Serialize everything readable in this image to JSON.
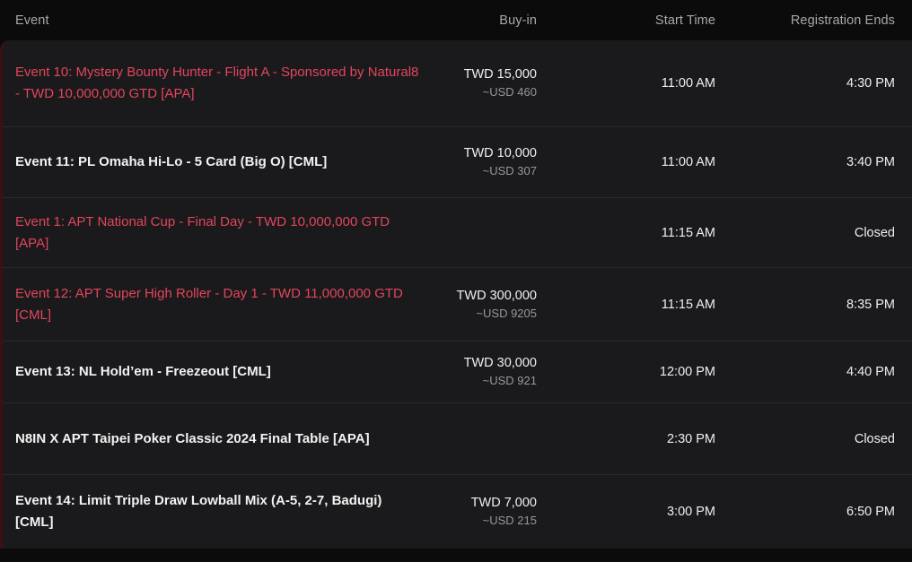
{
  "theme": {
    "page_bg": "#0b0b0b",
    "row_bg": "#1a1a1c",
    "row_divider": "#2a2a2d",
    "accent_red": "#e2455c",
    "accent_rail": "#3a1016",
    "text_primary": "#efefef",
    "text_muted": "#98989c",
    "header_text": "#a8a8ac"
  },
  "table": {
    "columns": {
      "event": "Event",
      "buyin": "Buy-in",
      "start_time": "Start Time",
      "registration_ends": "Registration Ends"
    },
    "rows": [
      {
        "event": "Event 10: Mystery Bounty Hunter - Flight A - Sponsored by Natural8 - TWD 10,000,000 GTD [APA]",
        "buyin_main": "TWD 15,000",
        "buyin_sub": "~USD 460",
        "start_time": "11:00 AM",
        "registration_ends": "4:30 PM",
        "highlight": true
      },
      {
        "event": "Event 11: PL Omaha Hi-Lo - 5 Card (Big O) [CML]",
        "buyin_main": "TWD 10,000",
        "buyin_sub": "~USD 307",
        "start_time": "11:00 AM",
        "registration_ends": "3:40 PM",
        "highlight": false
      },
      {
        "event": "Event 1: APT National Cup - Final Day - TWD 10,000,000 GTD [APA]",
        "buyin_main": "",
        "buyin_sub": "",
        "start_time": "11:15 AM",
        "registration_ends": "Closed",
        "highlight": true
      },
      {
        "event": "Event 12: APT Super High Roller - Day 1 - TWD 11,000,000 GTD [CML]",
        "buyin_main": "TWD 300,000",
        "buyin_sub": "~USD 9205",
        "start_time": "11:15 AM",
        "registration_ends": "8:35 PM",
        "highlight": true
      },
      {
        "event": "Event 13: NL Hold’em - Freezeout [CML]",
        "buyin_main": "TWD 30,000",
        "buyin_sub": "~USD 921",
        "start_time": "12:00 PM",
        "registration_ends": "4:40 PM",
        "highlight": false
      },
      {
        "event": "N8IN X APT Taipei Poker Classic 2024 Final Table [APA]",
        "buyin_main": "",
        "buyin_sub": "",
        "start_time": "2:30 PM",
        "registration_ends": "Closed",
        "highlight": false
      },
      {
        "event": "Event 14: Limit Triple Draw Lowball Mix (A-5, 2-7, Badugi) [CML]",
        "buyin_main": "TWD 7,000",
        "buyin_sub": "~USD 215",
        "start_time": "3:00 PM",
        "registration_ends": "6:50 PM",
        "highlight": false
      }
    ]
  }
}
